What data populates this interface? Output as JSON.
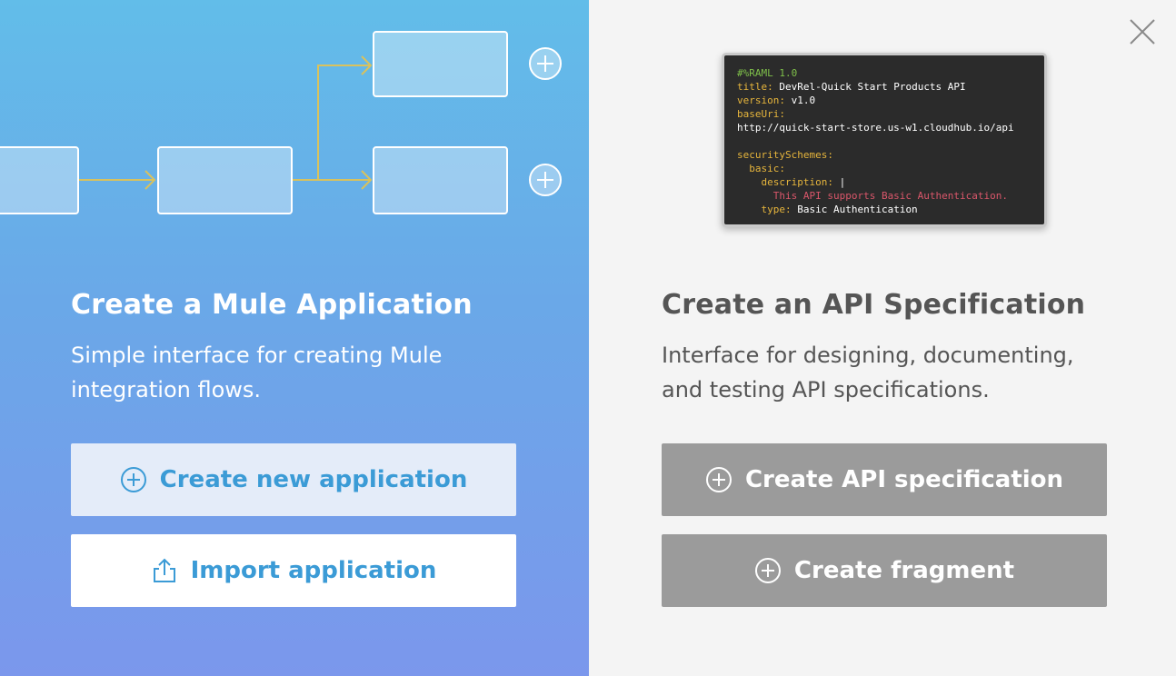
{
  "left_panel": {
    "title": "Create a Mule Application",
    "description": "Simple interface for creating Mule integration flows.",
    "buttons": {
      "create_new": {
        "label": "Create new application",
        "icon": "plus-circle-icon"
      },
      "import": {
        "label": "Import application",
        "icon": "upload-icon"
      }
    }
  },
  "right_panel": {
    "title": "Create an API Specification",
    "description": "Interface for designing, documenting, and testing API specifications.",
    "buttons": {
      "create_spec": {
        "label": "Create API specification",
        "icon": "plus-circle-icon"
      },
      "create_fragment": {
        "label": "Create fragment",
        "icon": "plus-circle-icon"
      }
    },
    "code_preview": {
      "line1": "#%RAML 1.0",
      "line2_key": "title:",
      "line2_val": " DevRel-Quick Start Products API",
      "line3_key": "version:",
      "line3_val": " v1.0",
      "line4_key": "baseUri:",
      "line5_val": "http://quick-start-store.us-w1.cloudhub.io/api",
      "line7_key": "securitySchemes:",
      "line8_key": "  basic:",
      "line9_key": "    description:",
      "line9_val": " |",
      "line10_str": "      This API supports Basic Authentication.",
      "line11_key": "    type:",
      "line11_val": " Basic Authentication"
    }
  },
  "close_button": {
    "icon": "close-icon"
  },
  "colors": {
    "accent_blue": "#3b9bd6",
    "gray_button": "#9b9b9b",
    "flow_line": "#d9c25d"
  }
}
